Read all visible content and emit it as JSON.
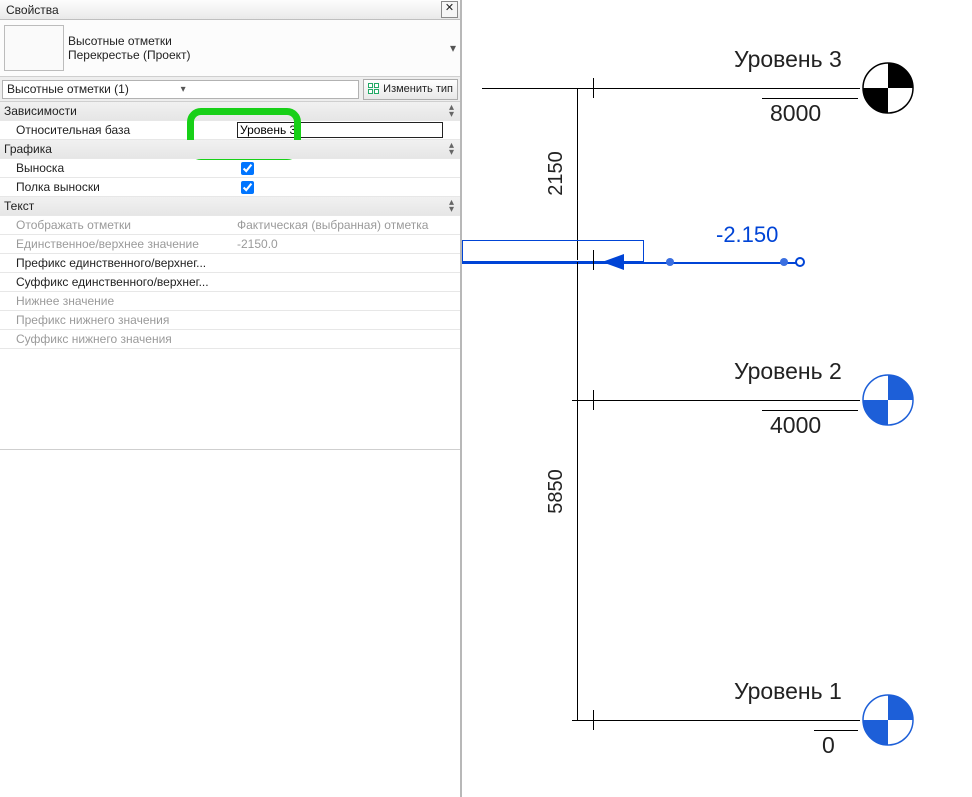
{
  "panel": {
    "title": "Свойства",
    "type_line1": "Высотные отметки",
    "type_line2": "Перекрестье (Проект)",
    "instance_label": "Высотные отметки (1)",
    "edit_type_btn": "Изменить тип"
  },
  "groups": {
    "deps": "Зависимости",
    "rel_base_label": "Относительная база",
    "rel_base_value": "Уровень 3",
    "graphics": "Графика",
    "leader": "Выноска",
    "shoulder": "Полка выноски",
    "text": "Текст",
    "disp_elev_label": "Отображать отметки",
    "disp_elev_value": "Фактическая (выбранная) отметка",
    "single_upper_label": "Единственное/верхнее значение",
    "single_upper_value": "-2150.0",
    "prefix_su": "Префикс единственного/верхнег...",
    "suffix_su": "Суффикс единственного/верхнег...",
    "lower_val": "Нижнее значение",
    "prefix_lower": "Префикс нижнего значения",
    "suffix_lower": "Суффикс нижнего значения"
  },
  "canvas": {
    "l3_name": "Уровень 3",
    "l3_val": "8000",
    "l2_name": "Уровень 2",
    "l2_val": "4000",
    "l1_name": "Уровень 1",
    "l1_val": "0",
    "dim1": "2150",
    "dim2": "5850",
    "spot": "-2.150"
  },
  "colors": {
    "accent": "#0044d6",
    "highlight": "#18d018"
  }
}
